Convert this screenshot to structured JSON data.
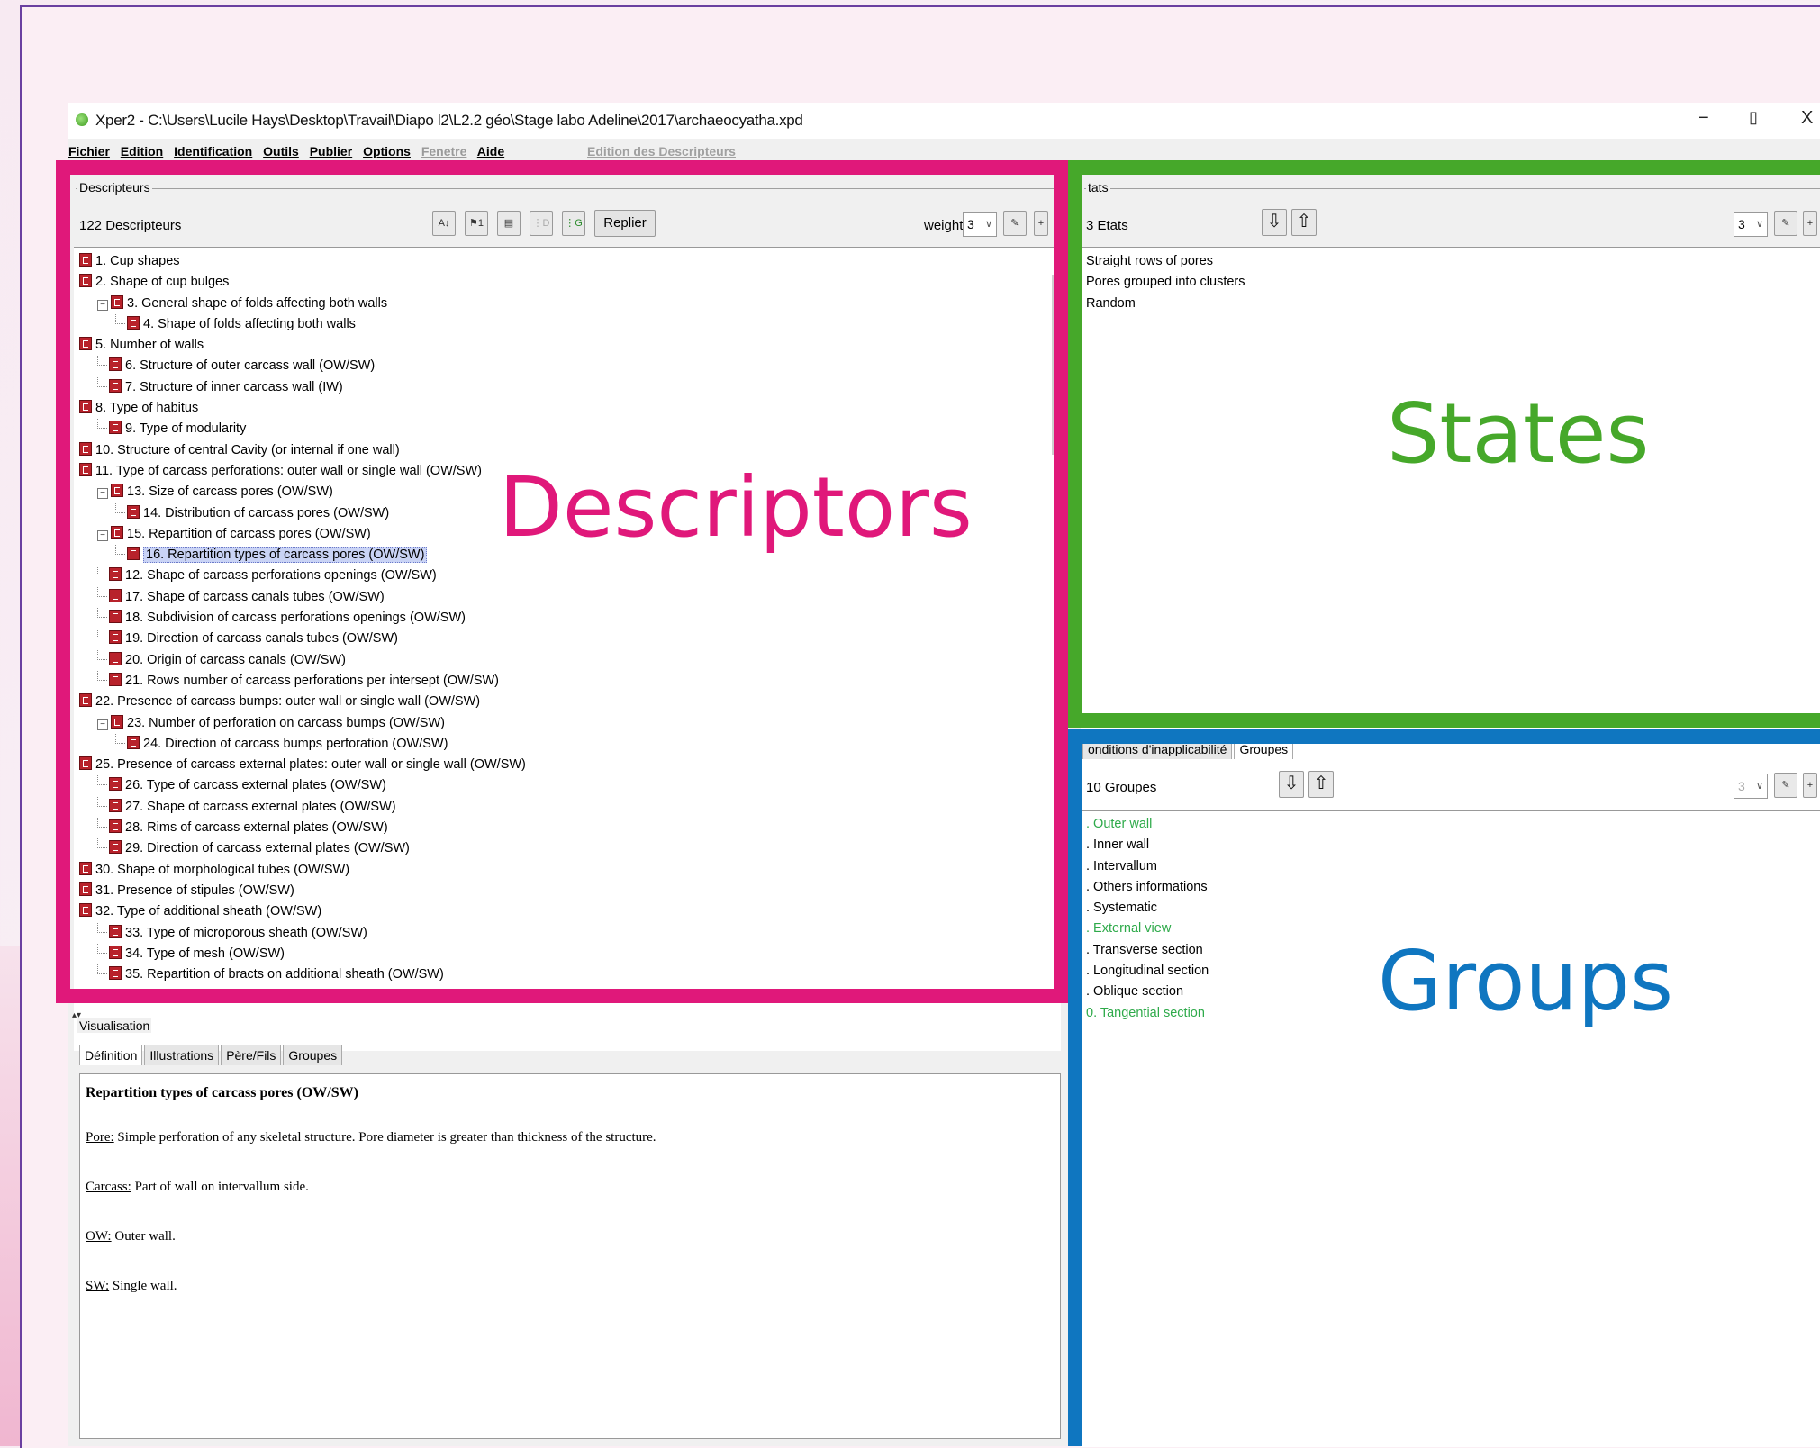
{
  "window": {
    "title": "Xper2 - C:\\Users\\Lucile Hays\\Desktop\\Travail\\Diapo l2\\L2.2 géo\\Stage labo Adeline\\2017\\archaeocyatha.xpd",
    "controls": {
      "minimize": "−",
      "restore": "▯",
      "close": "X"
    }
  },
  "menu": {
    "items": [
      "Fichier",
      "Edition",
      "Identification",
      "Outils",
      "Publier",
      "Options"
    ],
    "disabled_items": [
      "Fenetre"
    ],
    "help": "Aide",
    "edition_label": "Edition des Descripteurs"
  },
  "descriptors": {
    "legend": "Descripteurs",
    "count": "122 Descripteurs",
    "collapse_button": "Replier",
    "weight_label": "weight",
    "weight_value": "3",
    "items": [
      {
        "label": "1. Cup shapes"
      },
      {
        "label": "2. Shape of cup bulges"
      },
      {
        "label": "3. General shape of folds affecting both walls"
      },
      {
        "label": "4. Shape of folds affecting both walls"
      },
      {
        "label": "5. Number of walls"
      },
      {
        "label": "6. Structure of outer carcass wall (OW/SW)"
      },
      {
        "label": "7. Structure of inner carcass wall (IW)"
      },
      {
        "label": "8. Type of habitus"
      },
      {
        "label": "9. Type of modularity"
      },
      {
        "label": "10. Structure of central Cavity (or internal if one wall)"
      },
      {
        "label": "11. Type of carcass perforations: outer wall or single wall (OW/SW)"
      },
      {
        "label": "13. Size of carcass pores (OW/SW)"
      },
      {
        "label": "14. Distribution of carcass pores (OW/SW)"
      },
      {
        "label": "15. Repartition of carcass pores (OW/SW)"
      },
      {
        "label": "16. Repartition types of carcass pores (OW/SW)"
      },
      {
        "label": "12. Shape of carcass perforations openings (OW/SW)"
      },
      {
        "label": "17. Shape of carcass canals tubes (OW/SW)"
      },
      {
        "label": "18. Subdivision of carcass perforations openings (OW/SW)"
      },
      {
        "label": "19. Direction of carcass canals tubes (OW/SW)"
      },
      {
        "label": "20. Origin of carcass canals (OW/SW)"
      },
      {
        "label": "21. Rows number of carcass perforations per intersept (OW/SW)"
      },
      {
        "label": "22. Presence of carcass bumps: outer wall or single wall (OW/SW)"
      },
      {
        "label": "23. Number of perforation on carcass bumps (OW/SW)"
      },
      {
        "label": "24. Direction of carcass bumps perforation (OW/SW)"
      },
      {
        "label": "25. Presence of carcass external plates: outer wall or single wall (OW/SW)"
      },
      {
        "label": "26. Type of carcass external plates (OW/SW)"
      },
      {
        "label": "27. Shape of carcass external plates (OW/SW)"
      },
      {
        "label": "28. Rims of carcass external plates (OW/SW)"
      },
      {
        "label": "29. Direction of carcass external plates (OW/SW)"
      },
      {
        "label": "30. Shape of morphological tubes (OW/SW)"
      },
      {
        "label": "31. Presence of stipules (OW/SW)"
      },
      {
        "label": "32. Type of additional sheath (OW/SW)"
      },
      {
        "label": "33. Type of microporous sheath (OW/SW)"
      },
      {
        "label": "34. Type of mesh (OW/SW)"
      },
      {
        "label": "35. Repartition of bracts on additional sheath (OW/SW)"
      }
    ]
  },
  "states": {
    "legend": "tats",
    "count": "3 Etats",
    "weight_value": "3",
    "items": [
      "Straight rows of pores",
      "Pores grouped into clusters",
      "Random"
    ]
  },
  "groups": {
    "tabs": [
      "onditions d'inapplicabilité",
      "Groupes"
    ],
    "count": "10 Groupes",
    "weight_value": "3",
    "items": [
      {
        "label": ". Outer wall"
      },
      {
        "label": ". Inner wall"
      },
      {
        "label": ". Intervallum"
      },
      {
        "label": ". Others informations"
      },
      {
        "label": ". Systematic"
      },
      {
        "label": ". External view"
      },
      {
        "label": ". Transverse section"
      },
      {
        "label": ". Longitudinal section"
      },
      {
        "label": ". Oblique section"
      },
      {
        "label": "0. Tangential section"
      }
    ]
  },
  "visualisation": {
    "legend": "Visualisation",
    "tabs": [
      "Définition",
      "Illustrations",
      "Père/Fils",
      "Groupes"
    ],
    "heading": "Repartition types of carcass pores (OW/SW)",
    "definitions": [
      {
        "term": "Pore:",
        "text": " Simple perforation of any skeletal structure. Pore diameter is greater than thickness of the structure."
      },
      {
        "term": "Carcass:",
        "text": " Part of wall on intervallum side."
      },
      {
        "term": "OW:",
        "text": " Outer wall."
      },
      {
        "term": "SW:",
        "text": " Single wall."
      }
    ]
  },
  "annotations": {
    "descriptors": "Descriptors",
    "states": "States",
    "groups": "Groups",
    "colors": {
      "descriptors": "#e0187a",
      "states": "#46a82a",
      "groups": "#0f76c0"
    }
  }
}
